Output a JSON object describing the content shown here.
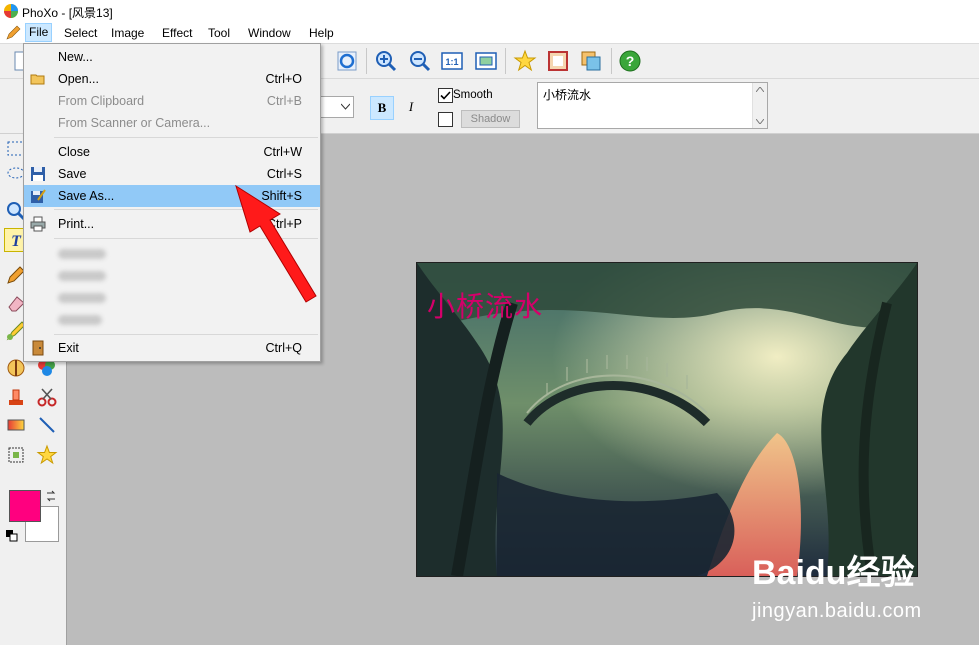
{
  "window": {
    "title": "PhoXo - [风景13]"
  },
  "menubar": {
    "items": [
      {
        "label": "File"
      },
      {
        "label": "Select"
      },
      {
        "label": "Image"
      },
      {
        "label": "Effect"
      },
      {
        "label": "Tool"
      },
      {
        "label": "Window"
      },
      {
        "label": "Help"
      }
    ]
  },
  "file_menu": {
    "items": [
      {
        "label": "New...",
        "shortcut": "",
        "icon": "new-file-icon"
      },
      {
        "label": "Open...",
        "shortcut": "Ctrl+O",
        "icon": "folder-open-icon"
      },
      {
        "label": "From Clipboard",
        "shortcut": "Ctrl+B",
        "disabled": true
      },
      {
        "label": "From Scanner or Camera...",
        "shortcut": "",
        "disabled": true
      },
      {
        "label": "Close",
        "shortcut": "Ctrl+W"
      },
      {
        "label": "Save",
        "shortcut": "Ctrl+S",
        "icon": "floppy-disk-icon"
      },
      {
        "label": "Save As...",
        "shortcut": "Shift+S",
        "icon": "save-as-icon",
        "highlighted": true
      },
      {
        "label": "Print...",
        "shortcut": "Ctrl+P",
        "icon": "printer-icon"
      },
      {
        "label": "Exit",
        "shortcut": "Ctrl+Q",
        "icon": "exit-door-icon"
      }
    ]
  },
  "text_options": {
    "bold_label": "B",
    "italic_label": "I",
    "smooth_label": "Smooth",
    "smooth_checked": true,
    "shadow_checked": false,
    "shadow_label": "Shadow",
    "text_value": "小桥流水"
  },
  "canvas": {
    "overlay_text": "小桥流水"
  },
  "colors": {
    "foreground": "#ff007f",
    "background": "#ffffff",
    "accent_highlight": "#91c9f7",
    "overlay_text": "#d4006a"
  },
  "watermark": {
    "brand": "Baidu经验",
    "url": "jingyan.baidu.com"
  }
}
